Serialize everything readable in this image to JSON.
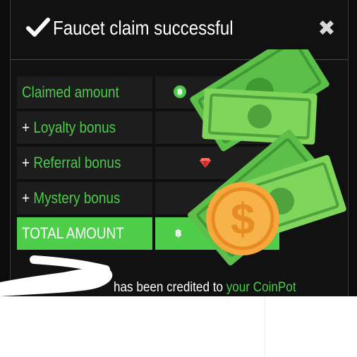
{
  "modal": {
    "title": "Faucet claim successful",
    "close_glyph": "✖",
    "check_icon": "checkmark-icon"
  },
  "rows": [
    {
      "plus": "",
      "label": "Claimed amount",
      "icon": "bitcoin-icon"
    },
    {
      "plus": "+ ",
      "label": "Loyalty bonus",
      "icon": ""
    },
    {
      "plus": "+ ",
      "label": "Referral bonus",
      "icon": "ruby-gem-icon"
    },
    {
      "plus": "+ ",
      "label": "Mystery bonus",
      "icon": ""
    }
  ],
  "total": {
    "label": "TOTAL AMOUNT",
    "icon": "bitcoin-icon"
  },
  "footer": {
    "text": "has been credited to ",
    "link": "your CoinPot"
  },
  "overlay": {
    "sticker": "money-bills-and-dollar-coin",
    "coin_symbol": "$"
  },
  "colors": {
    "accent_green": "#4ccb4a",
    "background": "#111111",
    "coin_orange": "#f7a73b"
  }
}
